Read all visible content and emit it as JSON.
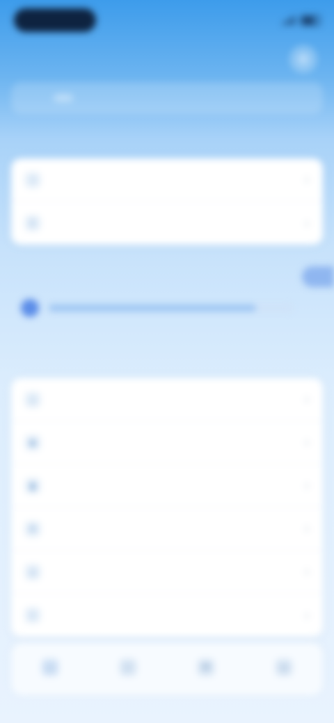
{
  "status_bar": {
    "time": "",
    "carrier": ""
  },
  "header": {
    "title": "",
    "subtitle": "",
    "settings_icon": "gear-icon"
  },
  "tabs": [
    {
      "label": ""
    },
    {
      "label": ""
    },
    {
      "label": ""
    }
  ],
  "section_general": {
    "label": "",
    "items": [
      {
        "label": "",
        "icon": "wifi-icon"
      },
      {
        "label": "",
        "icon": "bluetooth-icon"
      }
    ]
  },
  "highlight": {
    "title": "",
    "progress_fraction": 0.85
  },
  "section_more": {
    "label": "",
    "items": [
      {
        "label": "",
        "icon": "bell-icon"
      },
      {
        "label": "",
        "icon": "lock-icon"
      },
      {
        "label": "",
        "icon": "battery-icon"
      },
      {
        "label": "",
        "icon": "display-icon"
      },
      {
        "label": "",
        "icon": "sound-icon"
      },
      {
        "label": "",
        "icon": "info-icon"
      }
    ]
  },
  "bottom_nav": [
    {
      "label": "",
      "icon": "home-icon"
    },
    {
      "label": "",
      "icon": "search-icon"
    },
    {
      "label": "",
      "icon": "chat-icon"
    },
    {
      "label": "",
      "icon": "user-icon"
    }
  ],
  "colors": {
    "accent": "#3a84d6",
    "header_top": "#3d9ceb",
    "card_bg": "#ffffff"
  }
}
